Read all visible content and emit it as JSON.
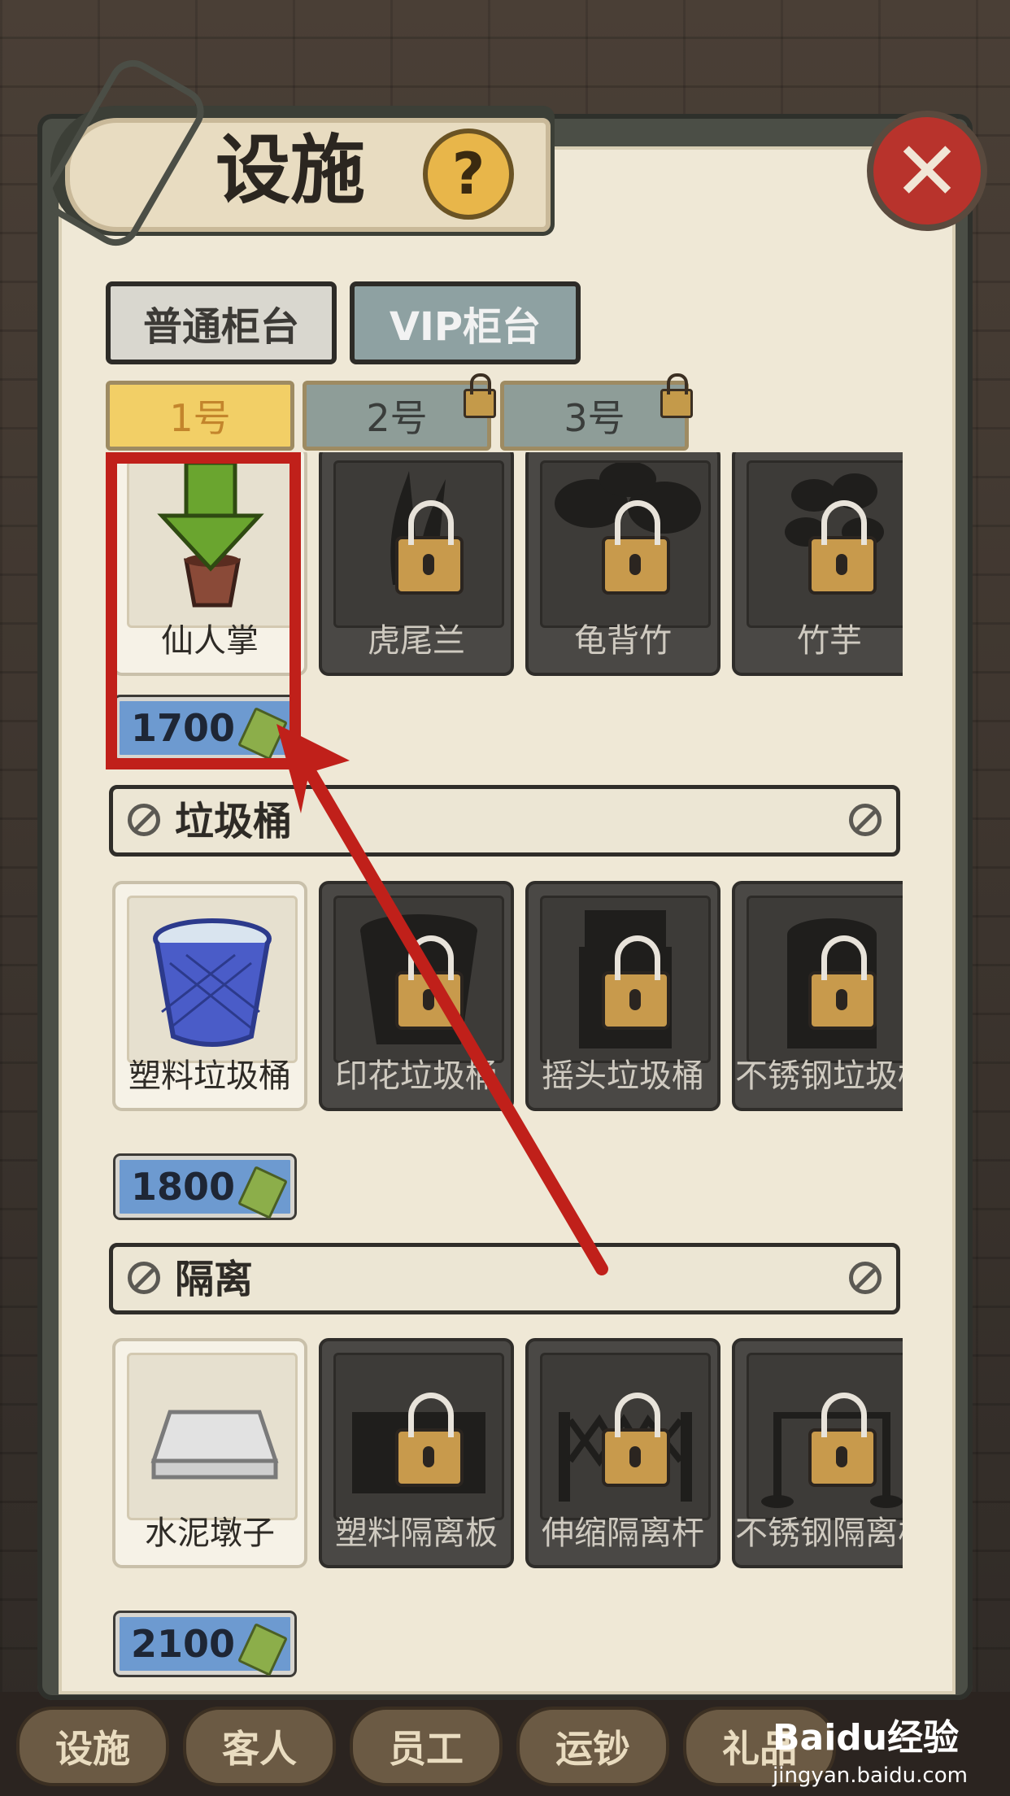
{
  "window": {
    "title": "设施",
    "help_symbol": "?",
    "close_symbol": "✕"
  },
  "counter_tabs": [
    {
      "label": "普通柜台",
      "active": false
    },
    {
      "label": "VIP柜台",
      "active": true
    }
  ],
  "number_tabs": [
    {
      "label": "1号",
      "locked": false,
      "active": true
    },
    {
      "label": "2号",
      "locked": true,
      "active": false
    },
    {
      "label": "3号",
      "locked": true,
      "active": false
    }
  ],
  "sections": [
    {
      "title": "",
      "items": [
        {
          "label": "仙人掌",
          "locked": false,
          "icon": "potted-cactus-icon"
        },
        {
          "label": "虎尾兰",
          "locked": true,
          "icon": "snake-plant-icon"
        },
        {
          "label": "龟背竹",
          "locked": true,
          "icon": "monstera-icon"
        },
        {
          "label": "竹芋",
          "locked": true,
          "icon": "calathea-icon"
        }
      ],
      "price": "1700"
    },
    {
      "title": "垃圾桶",
      "items": [
        {
          "label": "塑料垃圾桶",
          "locked": false,
          "icon": "plastic-trash-bin-icon"
        },
        {
          "label": "印花垃圾桶",
          "locked": true,
          "icon": "printed-trash-bin-icon"
        },
        {
          "label": "摇头垃圾桶",
          "locked": true,
          "icon": "swing-lid-trash-bin-icon"
        },
        {
          "label": "不锈钢垃圾桶",
          "locked": true,
          "icon": "steel-trash-bin-icon"
        }
      ],
      "price": "1800"
    },
    {
      "title": "隔离",
      "items": [
        {
          "label": "水泥墩子",
          "locked": false,
          "icon": "cement-block-icon"
        },
        {
          "label": "塑料隔离板",
          "locked": true,
          "icon": "plastic-barrier-icon"
        },
        {
          "label": "伸缩隔离杆",
          "locked": true,
          "icon": "retractable-barrier-icon"
        },
        {
          "label": "不锈钢隔离栏",
          "locked": true,
          "icon": "steel-stanchion-icon"
        }
      ],
      "price": "2100"
    }
  ],
  "bottom_nav": [
    "设施",
    "客人",
    "员工",
    "运钞",
    "礼品"
  ],
  "watermark": {
    "text": "Baidu经验",
    "url_text": "jingyan.baidu.com"
  },
  "colors": {
    "annotation_red": "#c0201a",
    "active_tab": "#f2cf66",
    "price_tag": "#6d9ad0",
    "close_button": "#b8332c",
    "arrow_green": "#6aa52f"
  }
}
